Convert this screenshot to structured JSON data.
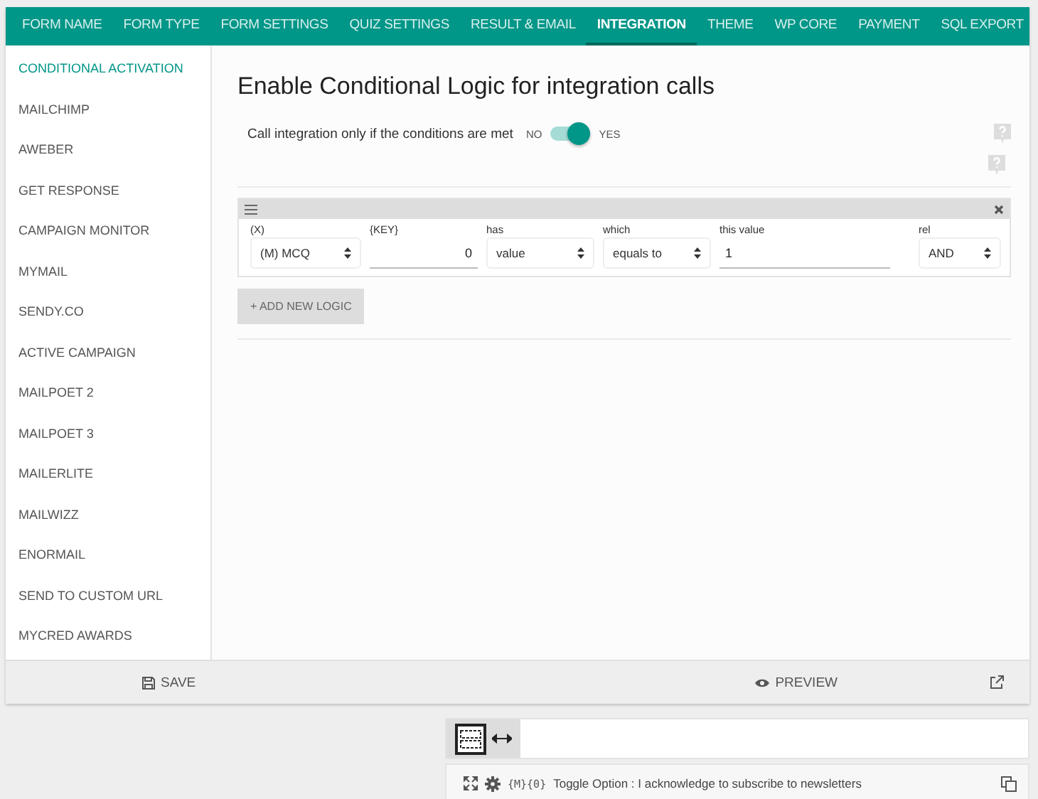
{
  "tabs": [
    {
      "label": "FORM NAME",
      "selected": false
    },
    {
      "label": "FORM TYPE",
      "selected": false
    },
    {
      "label": "FORM SETTINGS",
      "selected": false
    },
    {
      "label": "QUIZ SETTINGS",
      "selected": false
    },
    {
      "label": "RESULT & EMAIL",
      "selected": false
    },
    {
      "label": "INTEGRATION",
      "selected": true
    },
    {
      "label": "THEME",
      "selected": false
    },
    {
      "label": "WP CORE",
      "selected": false
    },
    {
      "label": "PAYMENT",
      "selected": false
    },
    {
      "label": "SQL EXPORT",
      "selected": false
    }
  ],
  "sidebar": {
    "items": [
      {
        "label": "CONDITIONAL ACTIVATION",
        "selected": true
      },
      {
        "label": "MAILCHIMP",
        "selected": false
      },
      {
        "label": "AWEBER",
        "selected": false
      },
      {
        "label": "GET RESPONSE",
        "selected": false
      },
      {
        "label": "CAMPAIGN MONITOR",
        "selected": false
      },
      {
        "label": "MYMAIL",
        "selected": false
      },
      {
        "label": "SENDY.CO",
        "selected": false
      },
      {
        "label": "ACTIVE CAMPAIGN",
        "selected": false
      },
      {
        "label": "MAILPOET 2",
        "selected": false
      },
      {
        "label": "MAILPOET 3",
        "selected": false
      },
      {
        "label": "MAILERLITE",
        "selected": false
      },
      {
        "label": "MAILWIZZ",
        "selected": false
      },
      {
        "label": "ENORMAIL",
        "selected": false
      },
      {
        "label": "SEND TO CUSTOM URL",
        "selected": false
      },
      {
        "label": "MYCRED AWARDS",
        "selected": false
      }
    ]
  },
  "content": {
    "heading": "Enable Conditional Logic for integration calls",
    "toggle": {
      "label": "Call integration only if the conditions are met",
      "off_label": "NO",
      "on_label": "YES",
      "on": true
    },
    "logic_fields": [
      {
        "kind": "select",
        "label": "(X)",
        "value": "(M) MCQ"
      },
      {
        "kind": "input",
        "label": "{KEY}",
        "value": "0"
      },
      {
        "kind": "select",
        "label": "has",
        "value": "value"
      },
      {
        "kind": "select",
        "label": "which",
        "value": "equals to"
      },
      {
        "kind": "input",
        "label": "this value",
        "value": "1"
      },
      {
        "kind": "select",
        "label": "rel",
        "value": "AND"
      }
    ],
    "add_button": "+ ADD NEW LOGIC"
  },
  "footer": {
    "save": "SAVE",
    "preview": "PREVIEW"
  },
  "element_bar": {
    "code": "{M}{0}",
    "text": "Toggle Option : I acknowledge to subscribe to newsletters"
  }
}
